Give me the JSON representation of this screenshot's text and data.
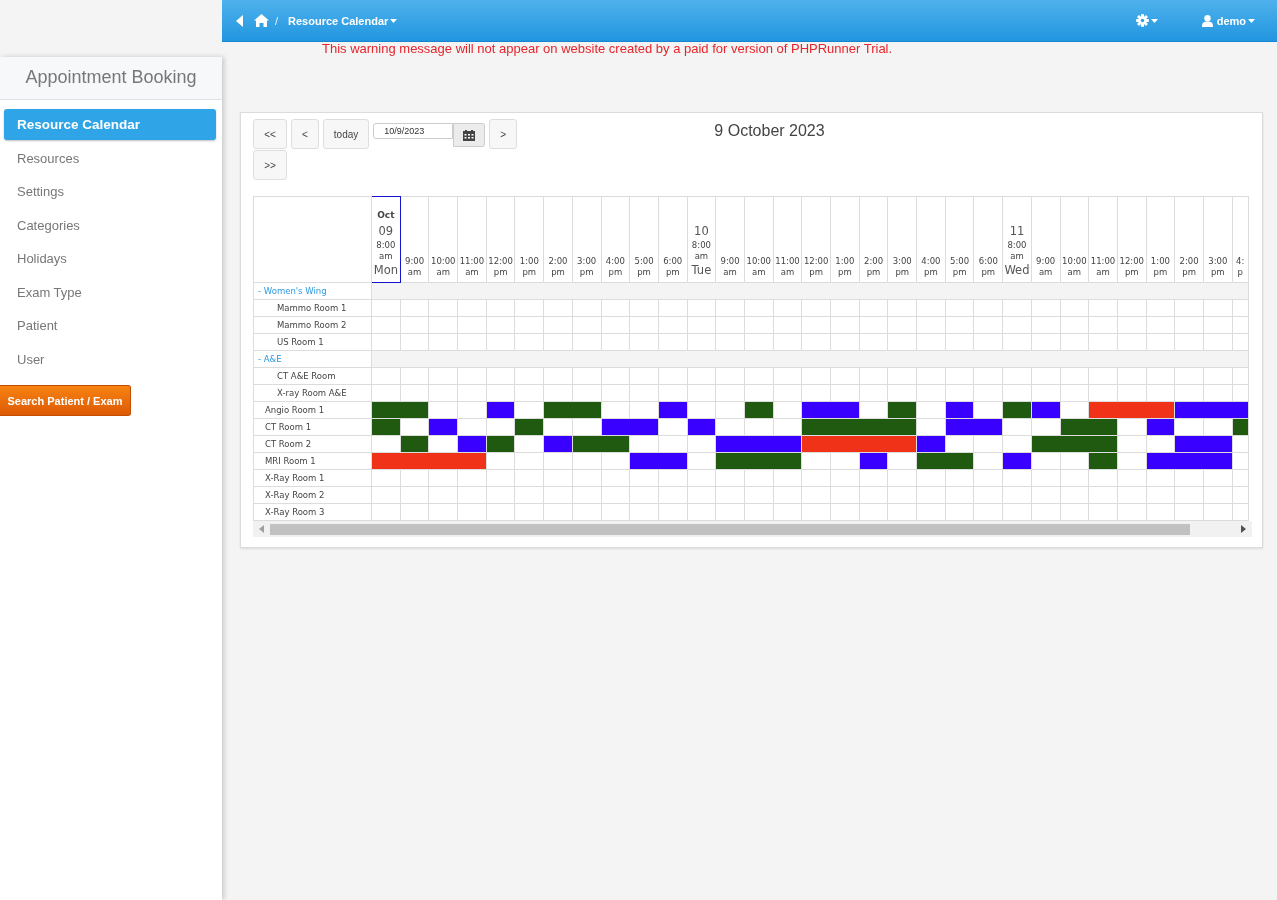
{
  "topbar": {
    "separator": "/",
    "breadcrumb": "Resource Calendar",
    "user": "demo"
  },
  "warning": "This warning message will not appear on website created by a paid for version of PHPRunner Trial.",
  "sidebar": {
    "title": "Appointment Booking",
    "items": [
      {
        "label": "Resource Calendar",
        "selected": true
      },
      {
        "label": "Resources",
        "selected": false
      },
      {
        "label": "Settings",
        "selected": false
      },
      {
        "label": "Categories",
        "selected": false
      },
      {
        "label": "Holidays",
        "selected": false
      },
      {
        "label": "Exam Type",
        "selected": false
      },
      {
        "label": "Patient",
        "selected": false
      },
      {
        "label": "User",
        "selected": false
      }
    ],
    "action_button": "Search Patient / Exam"
  },
  "calendar": {
    "buttons": [
      "<<",
      "<",
      "today"
    ],
    "date_value": "10/9/2023",
    "next_buttons": [
      ">",
      ">>"
    ],
    "title": "9 October 2023",
    "days": [
      {
        "month": "Oct",
        "day": "09",
        "weekday": "Mon",
        "today": true,
        "slots": [
          "8:00 am",
          "9:00 am",
          "10:00 am",
          "11:00 am",
          "12:00 pm",
          "1:00 pm",
          "2:00 pm",
          "3:00 pm",
          "4:00 pm",
          "5:00 pm",
          "6:00 pm"
        ]
      },
      {
        "day": "10",
        "weekday": "Tue",
        "today": false,
        "slots": [
          "8:00 am",
          "9:00 am",
          "10:00 am",
          "11:00 am",
          "12:00 pm",
          "1:00 pm",
          "2:00 pm",
          "3:00 pm",
          "4:00 pm",
          "5:00 pm",
          "6:00 pm"
        ]
      },
      {
        "day": "11",
        "weekday": "Wed",
        "today": false,
        "slots": [
          "8:00 am",
          "9:00 am",
          "10:00 am",
          "11:00 am",
          "12:00 pm",
          "1:00 pm",
          "2:00 pm",
          "3:00 pm",
          "4: p"
        ]
      }
    ],
    "rows": [
      {
        "kind": "group",
        "label": "- Women's Wing",
        "children": [
          {
            "label": "Mammo Room 1"
          },
          {
            "label": "Mammo Room 2"
          },
          {
            "label": "US Room 1"
          }
        ]
      },
      {
        "kind": "group",
        "label": "- A&E",
        "children": [
          {
            "label": "CT A&E Room"
          },
          {
            "label": "X-ray Room A&E"
          }
        ]
      },
      {
        "kind": "resource",
        "label": "Angio Room 1",
        "slots": [
          {
            "booked": true,
            "color": "#1f5a10"
          },
          {
            "booked": true,
            "color": "#1f5a10"
          },
          {
            "booked": false
          },
          {
            "booked": false
          },
          {
            "booked": true,
            "color": "#3a00ff"
          },
          {
            "booked": false
          },
          {
            "booked": true,
            "color": "#1f5a10"
          },
          {
            "booked": true,
            "color": "#1f5a10"
          },
          {
            "booked": false
          },
          {
            "booked": false
          },
          {
            "booked": true,
            "color": "#3a00ff"
          },
          {
            "booked": false
          },
          {
            "booked": false
          },
          {
            "booked": true,
            "color": "#1f5a10"
          },
          {
            "booked": false
          },
          {
            "booked": true,
            "color": "#3a00ff"
          },
          {
            "booked": true,
            "color": "#3a00ff"
          },
          {
            "booked": false
          },
          {
            "booked": true,
            "color": "#1f5a10"
          },
          {
            "booked": false
          },
          {
            "booked": true,
            "color": "#3a00ff"
          },
          {
            "booked": false
          },
          {
            "booked": true,
            "color": "#1f5a10"
          },
          {
            "booked": true,
            "color": "#3a00ff"
          },
          {
            "booked": false
          },
          {
            "booked": true,
            "color": "#f03219"
          },
          {
            "booked": true,
            "color": "#f03219"
          },
          {
            "booked": true,
            "color": "#f03219"
          },
          {
            "booked": true,
            "color": "#3a00ff"
          },
          {
            "booked": true,
            "color": "#3a00ff"
          },
          {
            "booked": true,
            "color": "#3a00ff"
          }
        ]
      },
      {
        "kind": "resource",
        "label": "CT Room 1",
        "slots": [
          {
            "booked": true,
            "color": "#1f5a10"
          },
          {
            "booked": false
          },
          {
            "booked": true,
            "color": "#3a00ff"
          },
          {
            "booked": false
          },
          {
            "booked": false
          },
          {
            "booked": true,
            "color": "#1f5a10"
          },
          {
            "booked": false
          },
          {
            "booked": false
          },
          {
            "booked": true,
            "color": "#3a00ff"
          },
          {
            "booked": true,
            "color": "#3a00ff"
          },
          {
            "booked": false
          },
          {
            "booked": true,
            "color": "#3a00ff"
          },
          {
            "booked": false
          },
          {
            "booked": false
          },
          {
            "booked": false
          },
          {
            "booked": true,
            "color": "#1f5a10"
          },
          {
            "booked": true,
            "color": "#1f5a10"
          },
          {
            "booked": true,
            "color": "#1f5a10"
          },
          {
            "booked": true,
            "color": "#1f5a10"
          },
          {
            "booked": false
          },
          {
            "booked": true,
            "color": "#3a00ff"
          },
          {
            "booked": true,
            "color": "#3a00ff"
          },
          {
            "booked": false
          },
          {
            "booked": false
          },
          {
            "booked": true,
            "color": "#1f5a10"
          },
          {
            "booked": true,
            "color": "#1f5a10"
          },
          {
            "booked": false
          },
          {
            "booked": true,
            "color": "#3a00ff"
          },
          {
            "booked": false
          },
          {
            "booked": false
          },
          {
            "booked": true,
            "color": "#1f5a10"
          }
        ]
      },
      {
        "kind": "resource",
        "label": "CT Room 2",
        "slots": [
          {
            "booked": false
          },
          {
            "booked": true,
            "color": "#1f5a10"
          },
          {
            "booked": false
          },
          {
            "booked": true,
            "color": "#3a00ff"
          },
          {
            "booked": true,
            "color": "#1f5a10"
          },
          {
            "booked": false
          },
          {
            "booked": true,
            "color": "#3a00ff"
          },
          {
            "booked": true,
            "color": "#1f5a10"
          },
          {
            "booked": true,
            "color": "#1f5a10"
          },
          {
            "booked": false
          },
          {
            "booked": false
          },
          {
            "booked": false
          },
          {
            "booked": true,
            "color": "#3a00ff"
          },
          {
            "booked": true,
            "color": "#3a00ff"
          },
          {
            "booked": true,
            "color": "#3a00ff"
          },
          {
            "booked": true,
            "color": "#f03219"
          },
          {
            "booked": true,
            "color": "#f03219"
          },
          {
            "booked": true,
            "color": "#f03219"
          },
          {
            "booked": true,
            "color": "#f03219"
          },
          {
            "booked": true,
            "color": "#3a00ff"
          },
          {
            "booked": false
          },
          {
            "booked": false
          },
          {
            "booked": false
          },
          {
            "booked": true,
            "color": "#1f5a10"
          },
          {
            "booked": true,
            "color": "#1f5a10"
          },
          {
            "booked": true,
            "color": "#1f5a10"
          },
          {
            "booked": false
          },
          {
            "booked": false
          },
          {
            "booked": true,
            "color": "#3a00ff"
          },
          {
            "booked": true,
            "color": "#3a00ff"
          },
          {
            "booked": false
          }
        ]
      },
      {
        "kind": "resource",
        "label": "MRI Room 1",
        "slots": [
          {
            "booked": true,
            "color": "#f03219"
          },
          {
            "booked": true,
            "color": "#f03219"
          },
          {
            "booked": true,
            "color": "#f03219"
          },
          {
            "booked": true,
            "color": "#f03219"
          },
          {
            "booked": false
          },
          {
            "booked": false
          },
          {
            "booked": false
          },
          {
            "booked": false
          },
          {
            "booked": false
          },
          {
            "booked": true,
            "color": "#3a00ff"
          },
          {
            "booked": true,
            "color": "#3a00ff"
          },
          {
            "booked": false
          },
          {
            "booked": true,
            "color": "#1f5a10"
          },
          {
            "booked": true,
            "color": "#1f5a10"
          },
          {
            "booked": true,
            "color": "#1f5a10"
          },
          {
            "booked": false
          },
          {
            "booked": false
          },
          {
            "booked": true,
            "color": "#3a00ff"
          },
          {
            "booked": false
          },
          {
            "booked": true,
            "color": "#1f5a10"
          },
          {
            "booked": true,
            "color": "#1f5a10"
          },
          {
            "booked": false
          },
          {
            "booked": true,
            "color": "#3a00ff"
          },
          {
            "booked": false
          },
          {
            "booked": false
          },
          {
            "booked": true,
            "color": "#1f5a10"
          },
          {
            "booked": false
          },
          {
            "booked": true,
            "color": "#3a00ff"
          },
          {
            "booked": true,
            "color": "#3a00ff"
          },
          {
            "booked": true,
            "color": "#3a00ff"
          },
          {
            "booked": false
          }
        ]
      },
      {
        "kind": "resource",
        "label": "X-Ray Room 1"
      },
      {
        "kind": "resource",
        "label": "X-Ray Room 2"
      },
      {
        "kind": "resource",
        "label": "X-Ray Room 3"
      }
    ]
  }
}
